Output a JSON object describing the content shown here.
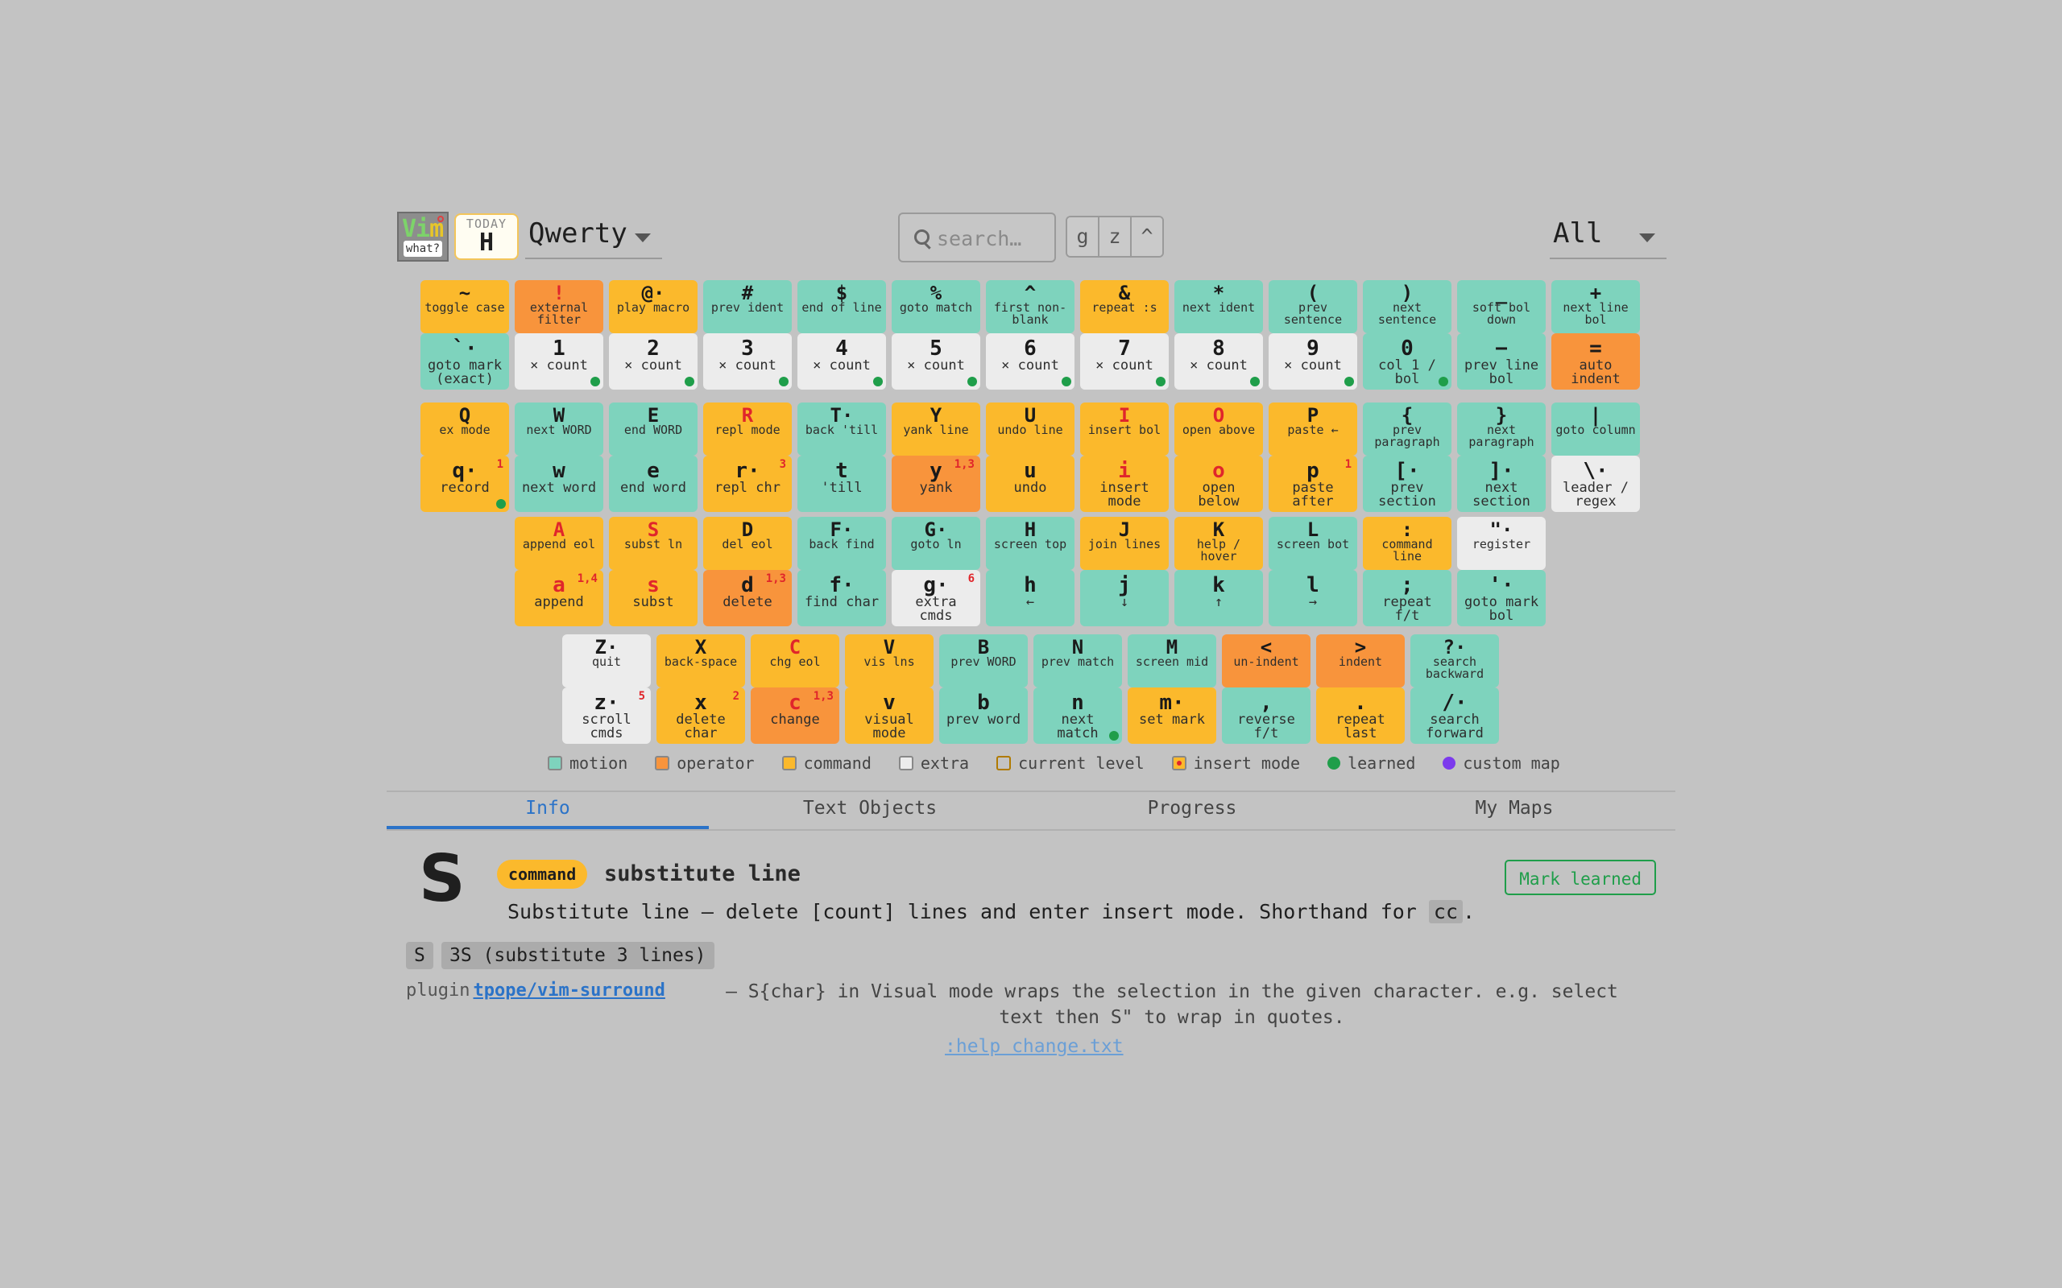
{
  "header": {
    "logo": {
      "text": "Vim",
      "badge": "what?"
    },
    "today": {
      "label": "TODAY",
      "key": "H"
    },
    "layout_select": "Qwerty",
    "search_placeholder": "search…",
    "mode_buttons": [
      "g",
      "z",
      "^"
    ],
    "filter_select": "All"
  },
  "keyboard": {
    "row1_shift": [
      {
        "key": "~",
        "desc": "toggle case",
        "type": "command"
      },
      {
        "key": "!",
        "desc": "external filter",
        "type": "operator",
        "red": true
      },
      {
        "key": "@·",
        "desc": "play macro",
        "type": "command"
      },
      {
        "key": "#",
        "desc": "prev ident",
        "type": "motion"
      },
      {
        "key": "$",
        "desc": "end of line",
        "type": "motion"
      },
      {
        "key": "%",
        "desc": "goto match",
        "type": "motion"
      },
      {
        "key": "^",
        "desc": "first non-blank",
        "type": "motion"
      },
      {
        "key": "&",
        "desc": "repeat :s",
        "type": "command"
      },
      {
        "key": "*",
        "desc": "next ident",
        "type": "motion"
      },
      {
        "key": "(",
        "desc": "prev sentence",
        "type": "motion"
      },
      {
        "key": ")",
        "desc": "next sentence",
        "type": "motion"
      },
      {
        "key": "_",
        "desc": "soft bol down",
        "type": "motion"
      },
      {
        "key": "+",
        "desc": "next line bol",
        "type": "motion"
      }
    ],
    "row1": [
      {
        "key": "`·",
        "desc": "goto mark (exact)",
        "type": "motion"
      },
      {
        "key": "1",
        "desc": "× count",
        "type": "extra",
        "learned": true
      },
      {
        "key": "2",
        "desc": "× count",
        "type": "extra",
        "learned": true
      },
      {
        "key": "3",
        "desc": "× count",
        "type": "extra",
        "learned": true
      },
      {
        "key": "4",
        "desc": "× count",
        "type": "extra",
        "learned": true
      },
      {
        "key": "5",
        "desc": "× count",
        "type": "extra",
        "learned": true
      },
      {
        "key": "6",
        "desc": "× count",
        "type": "extra",
        "learned": true
      },
      {
        "key": "7",
        "desc": "× count",
        "type": "extra",
        "learned": true
      },
      {
        "key": "8",
        "desc": "× count",
        "type": "extra",
        "learned": true
      },
      {
        "key": "9",
        "desc": "× count",
        "type": "extra",
        "learned": true
      },
      {
        "key": "0",
        "desc": "col 1 / bol",
        "type": "motion",
        "learned": true
      },
      {
        "key": "−",
        "desc": "prev line bol",
        "type": "motion"
      },
      {
        "key": "=",
        "desc": "auto indent",
        "type": "operator"
      }
    ],
    "row2_shift": [
      {
        "key": "Q",
        "desc": "ex mode",
        "type": "command"
      },
      {
        "key": "W",
        "desc": "next WORD",
        "type": "motion"
      },
      {
        "key": "E",
        "desc": "end WORD",
        "type": "motion"
      },
      {
        "key": "R",
        "desc": "repl mode",
        "type": "command",
        "red": true
      },
      {
        "key": "T·",
        "desc": "back 'till",
        "type": "motion"
      },
      {
        "key": "Y",
        "desc": "yank line",
        "type": "command"
      },
      {
        "key": "U",
        "desc": "undo line",
        "type": "command"
      },
      {
        "key": "I",
        "desc": "insert bol",
        "type": "command",
        "red": true
      },
      {
        "key": "O",
        "desc": "open above",
        "type": "command",
        "red": true
      },
      {
        "key": "P",
        "desc": "paste ←",
        "type": "command"
      },
      {
        "key": "{",
        "desc": "prev paragraph",
        "type": "motion"
      },
      {
        "key": "}",
        "desc": "next paragraph",
        "type": "motion"
      },
      {
        "key": "|",
        "desc": "goto column",
        "type": "motion"
      }
    ],
    "row2": [
      {
        "key": "q·",
        "desc": "record",
        "type": "command",
        "sup": "1",
        "learned": true
      },
      {
        "key": "w",
        "desc": "next word",
        "type": "motion"
      },
      {
        "key": "e",
        "desc": "end word",
        "type": "motion"
      },
      {
        "key": "r·",
        "desc": "repl chr",
        "type": "command",
        "sup": "3"
      },
      {
        "key": "t",
        "desc": "'till",
        "type": "motion"
      },
      {
        "key": "y",
        "desc": "yank",
        "type": "operator",
        "sup": "1,3"
      },
      {
        "key": "u",
        "desc": "undo",
        "type": "command"
      },
      {
        "key": "i",
        "desc": "insert mode",
        "type": "command",
        "red": true
      },
      {
        "key": "o",
        "desc": "open below",
        "type": "command",
        "red": true
      },
      {
        "key": "p",
        "desc": "paste after",
        "type": "command",
        "sup": "1"
      },
      {
        "key": "[·",
        "desc": "prev section",
        "type": "motion"
      },
      {
        "key": "]·",
        "desc": "next section",
        "type": "motion"
      },
      {
        "key": "\\·",
        "desc": "leader / regex",
        "type": "extra"
      }
    ],
    "row3_shift": [
      {
        "key": "A",
        "desc": "append eol",
        "type": "command",
        "red": true
      },
      {
        "key": "S",
        "desc": "subst ln",
        "type": "command",
        "red": true
      },
      {
        "key": "D",
        "desc": "del eol",
        "type": "command"
      },
      {
        "key": "F·",
        "desc": "back find",
        "type": "motion"
      },
      {
        "key": "G·",
        "desc": "goto ln",
        "type": "motion"
      },
      {
        "key": "H",
        "desc": "screen top",
        "type": "motion"
      },
      {
        "key": "J",
        "desc": "join lines",
        "type": "command"
      },
      {
        "key": "K",
        "desc": "help / hover",
        "type": "command"
      },
      {
        "key": "L",
        "desc": "screen bot",
        "type": "motion"
      },
      {
        "key": ":",
        "desc": "command line",
        "type": "command"
      },
      {
        "key": "\"·",
        "desc": "register",
        "type": "extra"
      }
    ],
    "row3": [
      {
        "key": "a",
        "desc": "append",
        "type": "command",
        "sup": "1,4",
        "red": true
      },
      {
        "key": "s",
        "desc": "subst",
        "type": "command",
        "red": true
      },
      {
        "key": "d",
        "desc": "delete",
        "type": "operator",
        "sup": "1,3"
      },
      {
        "key": "f·",
        "desc": "find char",
        "type": "motion"
      },
      {
        "key": "g·",
        "desc": "extra cmds",
        "type": "extra",
        "sup": "6"
      },
      {
        "key": "h",
        "desc": "←",
        "type": "motion"
      },
      {
        "key": "j",
        "desc": "↓",
        "type": "motion"
      },
      {
        "key": "k",
        "desc": "↑",
        "type": "motion"
      },
      {
        "key": "l",
        "desc": "→",
        "type": "motion"
      },
      {
        "key": ";",
        "desc": "repeat f/t",
        "type": "motion"
      },
      {
        "key": "'·",
        "desc": "goto mark bol",
        "type": "motion"
      }
    ],
    "row4_shift": [
      {
        "key": "Z·",
        "desc": "quit",
        "type": "extra"
      },
      {
        "key": "X",
        "desc": "back-space",
        "type": "command"
      },
      {
        "key": "C",
        "desc": "chg eol",
        "type": "command",
        "red": true
      },
      {
        "key": "V",
        "desc": "vis lns",
        "type": "command"
      },
      {
        "key": "B",
        "desc": "prev WORD",
        "type": "motion"
      },
      {
        "key": "N",
        "desc": "prev match",
        "type": "motion"
      },
      {
        "key": "M",
        "desc": "screen mid",
        "type": "motion"
      },
      {
        "key": "<",
        "desc": "un-indent",
        "type": "operator"
      },
      {
        "key": ">",
        "desc": "indent",
        "type": "operator"
      },
      {
        "key": "?·",
        "desc": "search backward",
        "type": "motion"
      }
    ],
    "row4": [
      {
        "key": "z·",
        "desc": "scroll cmds",
        "type": "extra",
        "sup": "5"
      },
      {
        "key": "x",
        "desc": "delete char",
        "type": "command",
        "sup": "2"
      },
      {
        "key": "c",
        "desc": "change",
        "type": "operator",
        "sup": "1,3",
        "red": true
      },
      {
        "key": "v",
        "desc": "visual mode",
        "type": "command"
      },
      {
        "key": "b",
        "desc": "prev word",
        "type": "motion"
      },
      {
        "key": "n",
        "desc": "next match",
        "type": "motion",
        "learned": true
      },
      {
        "key": "m·",
        "desc": "set mark",
        "type": "command"
      },
      {
        "key": ",",
        "desc": "reverse f/t",
        "type": "motion"
      },
      {
        "key": ".",
        "desc": "repeat last",
        "type": "command"
      },
      {
        "key": "/·",
        "desc": "search forward",
        "type": "motion"
      }
    ]
  },
  "legend": [
    {
      "label": "motion",
      "kind": "swatch",
      "color": "#7ed3bd"
    },
    {
      "label": "operator",
      "kind": "swatch",
      "color": "#f8943c"
    },
    {
      "label": "command",
      "kind": "swatch",
      "color": "#fbb92c"
    },
    {
      "label": "extra",
      "kind": "swatch",
      "color": "#ececec"
    },
    {
      "label": "current level",
      "kind": "outline",
      "color": "#fbb92c"
    },
    {
      "label": "insert mode",
      "kind": "dot",
      "color": "#fbb92c"
    },
    {
      "label": "learned",
      "kind": "circle",
      "color": "#1f9e4a"
    },
    {
      "label": "custom map",
      "kind": "circle",
      "color": "#7c3aed"
    }
  ],
  "tabs": [
    "Info",
    "Text Objects",
    "Progress",
    "My Maps"
  ],
  "info": {
    "key": "S",
    "category": "command",
    "title": "substitute line",
    "mark_button": "Mark learned",
    "description": "Substitute line — delete [count] lines and enter insert mode. Shorthand for",
    "description_code": "cc",
    "description_end": ".",
    "examples": [
      "S",
      "3S (substitute 3 lines)"
    ],
    "plugin_label": "plugin",
    "plugin_name": "tpope/vim-surround",
    "plugin_desc": "— S{char} in Visual mode wraps the selection in the given character. e.g. select text then S\" to wrap in quotes.",
    "help_link": ":help change.txt"
  },
  "colors": {
    "motion": "#7ed3bd",
    "operator": "#f8943c",
    "command": "#fbb92c",
    "extra": "#ececec",
    "accent": "#2b73c8",
    "learned": "#1f9e4a"
  }
}
